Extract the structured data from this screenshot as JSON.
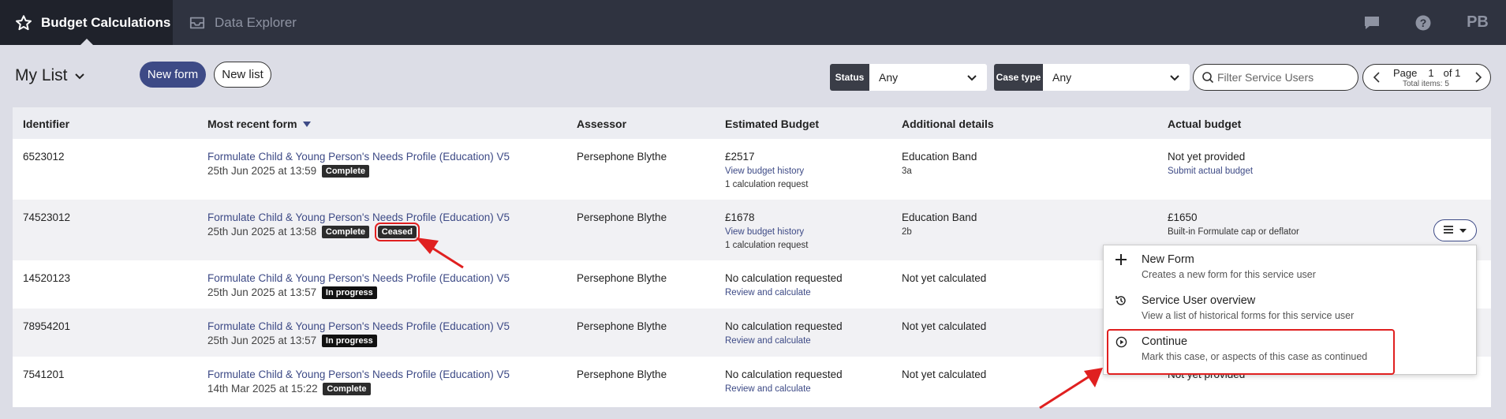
{
  "nav": {
    "tabs": [
      {
        "label": "Budget Calculations",
        "icon": "star-icon",
        "active": true
      },
      {
        "label": "Data Explorer",
        "icon": "inbox-icon",
        "active": false
      }
    ],
    "icons": [
      "chat-icon",
      "help-icon"
    ],
    "user_initials": "PB"
  },
  "toolbar": {
    "list_title": "My List",
    "new_form_label": "New form",
    "new_list_label": "New list",
    "status_label": "Status",
    "status_value": "Any",
    "case_type_label": "Case type",
    "case_type_value": "Any",
    "search_placeholder": "Filter Service Users",
    "page_label": "Page",
    "page_current": "1",
    "page_of": "of 1",
    "total_items": "Total items: 5"
  },
  "table": {
    "headers": [
      "Identifier",
      "Most recent form",
      "Assessor",
      "Estimated Budget",
      "Additional details",
      "Actual budget"
    ],
    "rows": [
      {
        "id": "6523012",
        "form": "Formulate Child & Young Person's Needs Profile (Education) V5",
        "date": "25th Jun 2025 at 13:59",
        "badges": [
          "Complete"
        ],
        "assessor": "Persephone Blythe",
        "budget": "£2517",
        "budget_link": "View budget history",
        "budget_note": "1 calculation request",
        "details": "Education Band",
        "details_sub": "3a",
        "actual": "Not yet provided",
        "actual_sub": "Submit actual budget"
      },
      {
        "id": "74523012",
        "form": "Formulate Child & Young Person's Needs Profile (Education) V5",
        "date": "25th Jun 2025 at 13:58",
        "badges": [
          "Complete",
          "Ceased"
        ],
        "assessor": "Persephone Blythe",
        "budget": "£1678",
        "budget_link": "View budget history",
        "budget_note": "1 calculation request",
        "details": "Education Band",
        "details_sub": "2b",
        "actual": "£1650",
        "actual_sub": "Built-in Formulate cap or deflator"
      },
      {
        "id": "14520123",
        "form": "Formulate Child & Young Person's Needs Profile (Education) V5",
        "date": "25th Jun 2025 at 13:57",
        "badges": [
          "In progress"
        ],
        "assessor": "Persephone Blythe",
        "budget": "No calculation requested",
        "budget_link": "Review and calculate",
        "details": "Not yet calculated"
      },
      {
        "id": "78954201",
        "form": "Formulate Child & Young Person's Needs Profile (Education) V5",
        "date": "25th Jun 2025 at 13:57",
        "badges": [
          "In progress"
        ],
        "assessor": "Persephone Blythe",
        "budget": "No calculation requested",
        "budget_link": "Review and calculate",
        "details": "Not yet calculated"
      },
      {
        "id": "7541201",
        "form": "Formulate Child & Young Person's Needs Profile (Education) V5",
        "date": "14th Mar 2025 at 15:22",
        "badges": [
          "Complete"
        ],
        "assessor": "Persephone Blythe",
        "budget": "No calculation requested",
        "budget_link": "Review and calculate",
        "details": "Not yet calculated",
        "actual": "Not yet provided"
      }
    ]
  },
  "menu": {
    "items": [
      {
        "title": "New Form",
        "desc": "Creates a new form for this service user",
        "icon": "plus-icon"
      },
      {
        "title": "Service User overview",
        "desc": "View a list of historical forms for this service user",
        "icon": "history-icon"
      },
      {
        "title": "Continue",
        "desc": "Mark this case, or aspects of this case as continued",
        "icon": "play-circle-icon"
      }
    ]
  },
  "colors": {
    "nav_bg": "#2f3340",
    "nav_active": "#1f222b",
    "accent": "#3d4a86",
    "annotation": "#e02020"
  }
}
